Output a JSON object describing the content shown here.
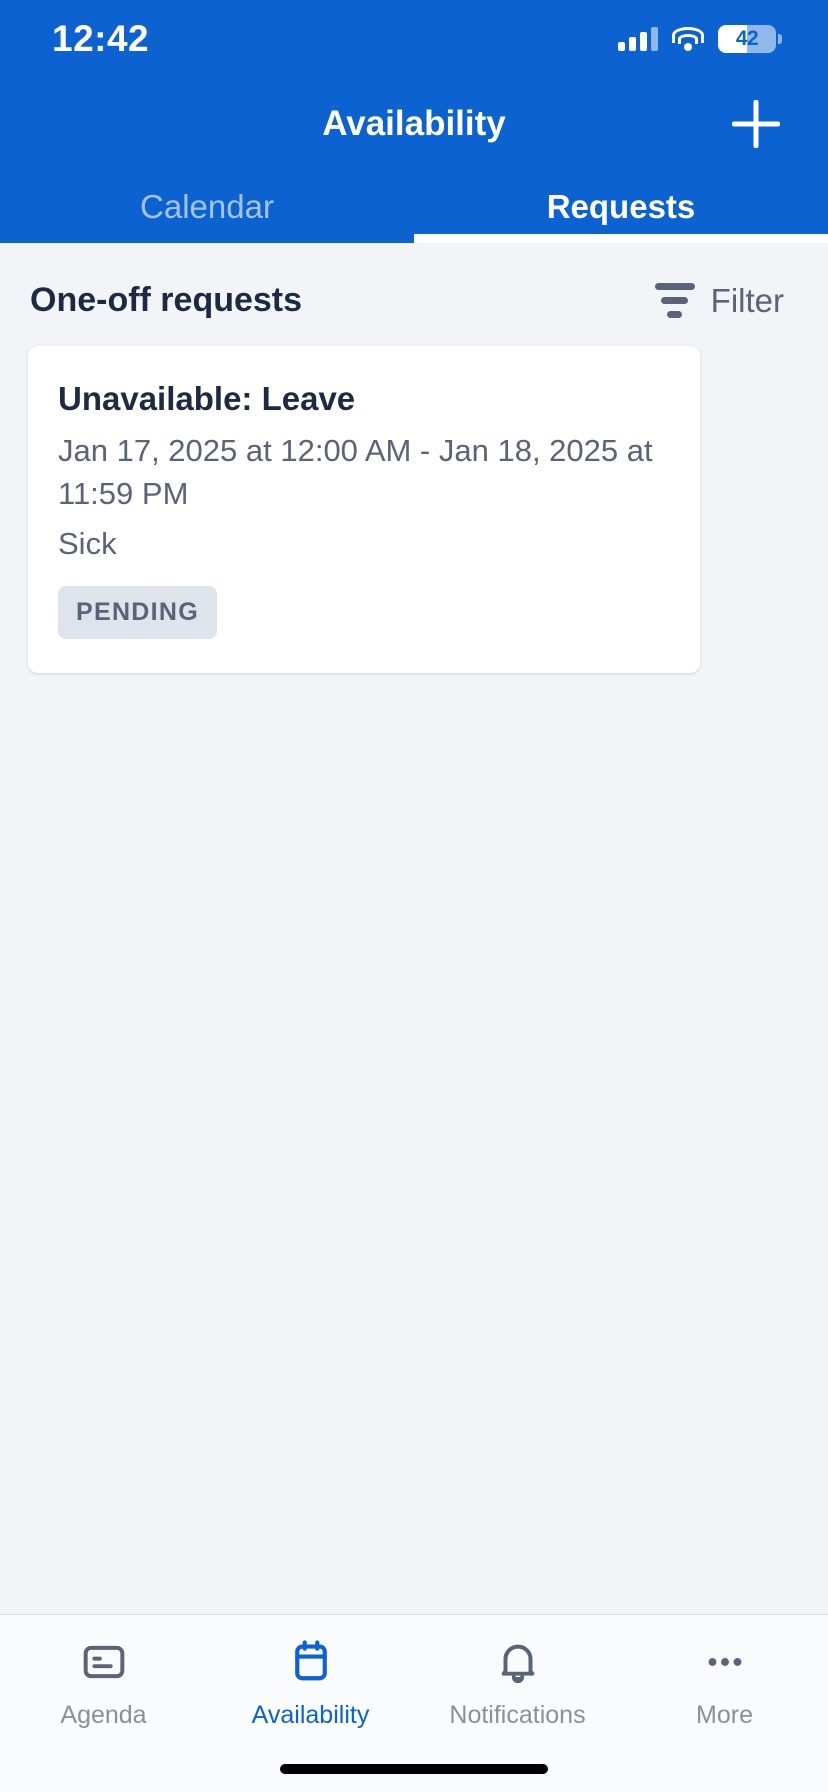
{
  "status_bar": {
    "time": "12:42",
    "signal_icon": "cellular-signal-icon",
    "wifi_icon": "wifi-icon",
    "battery_icon": "battery-icon",
    "battery_percent": "42"
  },
  "header": {
    "title": "Availability",
    "add_icon": "plus-icon",
    "accent_color": "#0B62D0",
    "tabs": [
      {
        "label": "Calendar",
        "active": false
      },
      {
        "label": "Requests",
        "active": true
      }
    ]
  },
  "content": {
    "section_title": "One-off requests",
    "filter": {
      "label": "Filter",
      "icon": "filter-icon"
    },
    "requests": [
      {
        "title": "Unavailable: Leave",
        "date_range": "Jan 17, 2025 at 12:00 AM - Jan 18, 2025 at 11:59 PM",
        "reason": "Sick",
        "status": "PENDING",
        "status_bg": "#DFE3EC",
        "status_color": "#5A6378"
      }
    ]
  },
  "bottom_nav": {
    "active_color": "#0B62D0",
    "inactive_color": "#8A8F99",
    "items": [
      {
        "label": "Agenda",
        "icon": "agenda-icon",
        "active": false
      },
      {
        "label": "Availability",
        "icon": "calendar-icon",
        "active": true
      },
      {
        "label": "Notifications",
        "icon": "bell-icon",
        "active": false
      },
      {
        "label": "More",
        "icon": "ellipsis-icon",
        "active": false
      }
    ]
  }
}
